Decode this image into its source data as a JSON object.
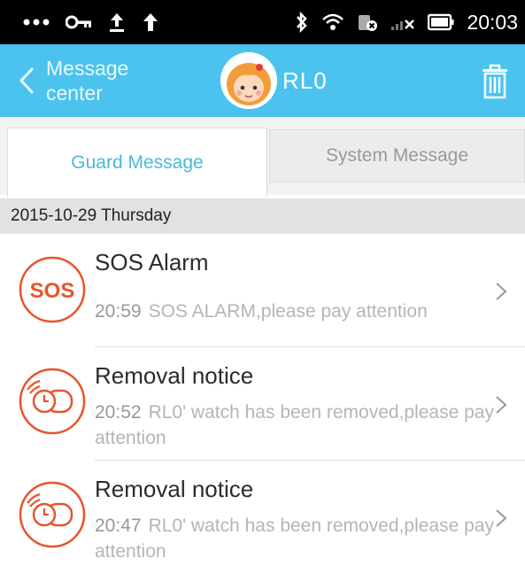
{
  "status_bar": {
    "time": "20:03",
    "icons": [
      "more-dots-icon",
      "key-icon",
      "upload-icon",
      "arrow-up-icon",
      "bluetooth-icon",
      "wifi-icon",
      "sim-icon",
      "signal-icon",
      "battery-icon"
    ]
  },
  "header": {
    "back_label": "Message center",
    "title": "RL0",
    "background": "#4cc3ee",
    "icons": [
      "back-chevron-icon",
      "avatar",
      "trash-icon"
    ]
  },
  "tabs": [
    {
      "label": "Guard Message",
      "active": true
    },
    {
      "label": "System Message",
      "active": false
    }
  ],
  "accent": "#e8542c",
  "date_header": "2015-10-29 Thursday",
  "messages": [
    {
      "icon": "sos-icon",
      "title": "SOS Alarm",
      "time": "20:59",
      "text": "SOS ALARM,please pay attention"
    },
    {
      "icon": "watch-removed-icon",
      "title": "Removal notice",
      "time": "20:52",
      "text": "RL0' watch has been removed,please pay attention"
    },
    {
      "icon": "watch-removed-icon",
      "title": "Removal notice",
      "time": "20:47",
      "text": "RL0' watch has been removed,please pay attention"
    }
  ]
}
